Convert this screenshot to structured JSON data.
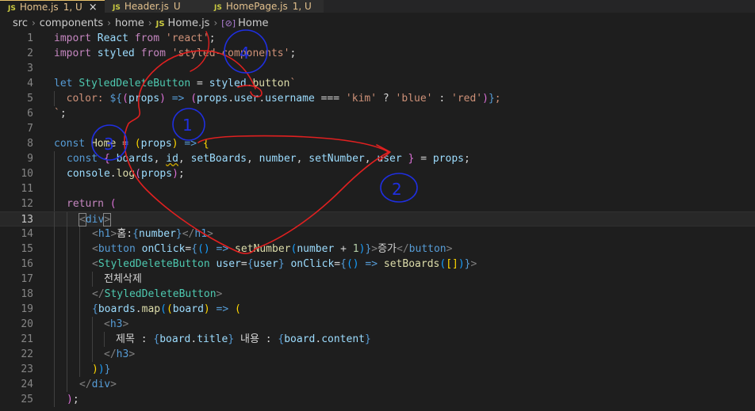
{
  "tabs": [
    {
      "icon": "JS",
      "name": "Home.js",
      "status": "1, U",
      "close": "×"
    },
    {
      "icon": "JS",
      "name": "Header.js",
      "status": "U"
    },
    {
      "icon": "JS",
      "name": "HomePage.js",
      "status": "1, U"
    }
  ],
  "breadcrumb": {
    "p1": "src",
    "p2": "components",
    "p3": "home",
    "icon": "JS",
    "p4": "Home.js",
    "sym": "[⊘]",
    "p5": "Home"
  },
  "line_numbers": [
    "1",
    "2",
    "3",
    "4",
    "5",
    "6",
    "7",
    "8",
    "9",
    "10",
    "11",
    "12",
    "13",
    "14",
    "15",
    "16",
    "17",
    "18",
    "19",
    "20",
    "21",
    "22",
    "23",
    "24",
    "25"
  ],
  "code": {
    "l1": [
      "import",
      "React",
      "from",
      "'react'",
      ";"
    ],
    "l2": [
      "import",
      "styled",
      "from",
      "'styled-components'",
      ";"
    ],
    "l4": [
      "let",
      "StyledDeleteButton",
      "=",
      "styled",
      ".",
      "button",
      "`"
    ],
    "l5": [
      "  color: ",
      "${",
      "(",
      "props",
      ")",
      " => ",
      "(",
      "props",
      ".",
      "user",
      ".",
      "username",
      " === ",
      "'kim'",
      " ? ",
      "'blue'",
      " : ",
      "'red'",
      ")",
      "}",
      ";"
    ],
    "l6": [
      "`",
      ";"
    ],
    "l8": [
      "const",
      "Home",
      "=",
      "(",
      "props",
      ")",
      "=>",
      "{"
    ],
    "l9": [
      "const",
      "{",
      "boards",
      ",",
      "id",
      ",",
      "setBoards",
      ",",
      "number",
      ",",
      "setNumber",
      ",",
      "user",
      "}",
      "=",
      "props",
      ";"
    ],
    "l10": [
      "console",
      ".",
      "log",
      "(",
      "props",
      ")",
      ";"
    ],
    "l12": [
      "return",
      "("
    ],
    "l13": [
      "<",
      "div",
      ">"
    ],
    "l14": [
      "<",
      "h1",
      ">",
      "홈:",
      "{",
      "number",
      "}",
      "</",
      "h1",
      ">"
    ],
    "l15": [
      "<",
      "button",
      "onClick",
      "=",
      "{",
      "()",
      " => ",
      "setNumber",
      "(",
      "number",
      " + ",
      "1",
      ")",
      "}",
      ">",
      "증가",
      "</",
      "button",
      ">"
    ],
    "l16": [
      "<",
      "StyledDeleteButton",
      "user",
      "=",
      "{",
      "user",
      "}",
      "onClick",
      "=",
      "{",
      "()",
      " => ",
      "setBoards",
      "(",
      "[",
      "]",
      ")",
      "}",
      ">"
    ],
    "l17": [
      "전체삭제"
    ],
    "l18": [
      "</",
      "StyledDeleteButton",
      ">"
    ],
    "l19": [
      "{",
      "boards",
      ".",
      "map",
      "(",
      "(",
      "board",
      ")",
      " => ",
      "("
    ],
    "l20": [
      "<",
      "h3",
      ">"
    ],
    "l21": [
      "제목 : ",
      "{",
      "board",
      ".",
      "title",
      "}",
      " 내용 : ",
      "{",
      "board",
      ".",
      "content",
      "}"
    ],
    "l22": [
      "</",
      "h3",
      ">"
    ],
    "l23": [
      ")",
      ")",
      "}"
    ],
    "l24": [
      "</",
      "div",
      ">"
    ],
    "l25": [
      ")",
      ";"
    ]
  },
  "annotations": {
    "one": "1",
    "two": "2",
    "three": "3",
    "four": "4"
  },
  "colors": {
    "editor_bg": "#1e1e1e",
    "keyword": "#c586c0",
    "variable": "#9cdcfe",
    "string": "#ce9178",
    "tag": "#569cd6",
    "ink_red": "#e02020",
    "ink_blue": "#1f2fe0"
  }
}
